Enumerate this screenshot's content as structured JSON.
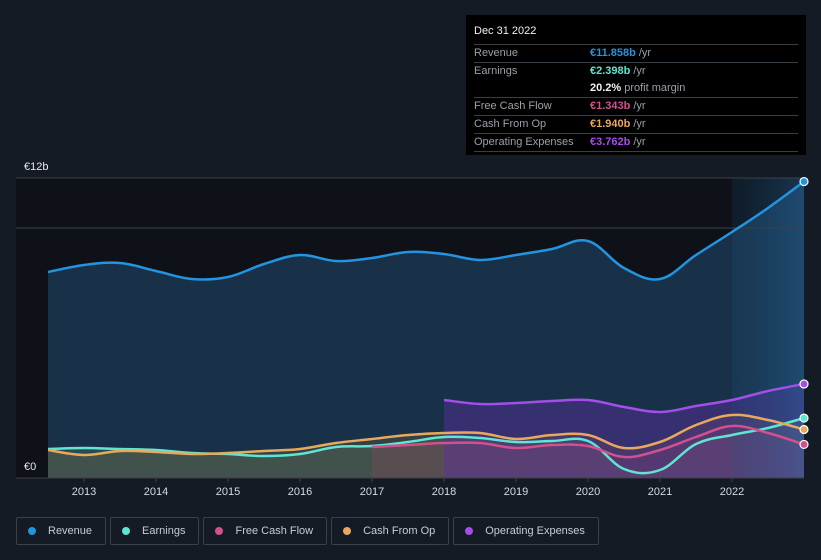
{
  "tooltip": {
    "date": "Dec 31 2022",
    "rows": [
      {
        "label": "Revenue",
        "value": "€11.858b",
        "unit": "/yr",
        "color": "#2394df"
      },
      {
        "label": "Earnings",
        "value": "€2.398b",
        "unit": "/yr",
        "color": "#5ee6d0"
      },
      {
        "label": "",
        "value": "20.2%",
        "unit": "profit margin",
        "color": "#f2f2f2"
      },
      {
        "label": "Free Cash Flow",
        "value": "€1.343b",
        "unit": "/yr",
        "color": "#d2508e"
      },
      {
        "label": "Cash From Op",
        "value": "€1.940b",
        "unit": "/yr",
        "color": "#e8a95c"
      },
      {
        "label": "Operating Expenses",
        "value": "€3.762b",
        "unit": "/yr",
        "color": "#a24ee8"
      }
    ]
  },
  "legend": [
    {
      "label": "Revenue",
      "color": "#2394df"
    },
    {
      "label": "Earnings",
      "color": "#5ee6d0"
    },
    {
      "label": "Free Cash Flow",
      "color": "#d2508e"
    },
    {
      "label": "Cash From Op",
      "color": "#e8a95c"
    },
    {
      "label": "Operating Expenses",
      "color": "#a24ee8"
    }
  ],
  "chart_data": {
    "type": "area",
    "title": "",
    "xlabel": "",
    "ylabel": "",
    "y_ticks": [
      "€0",
      "€12b"
    ],
    "ylim": [
      0,
      12
    ],
    "xlim": [
      2012.5,
      2023.0
    ],
    "x_ticks": [
      "2013",
      "2014",
      "2015",
      "2016",
      "2017",
      "2018",
      "2019",
      "2020",
      "2021",
      "2022"
    ],
    "highlight_from": 2022.0,
    "grid": true,
    "legend_position": "bottom-left",
    "series": [
      {
        "name": "Revenue",
        "color": "#2394df",
        "x": [
          2012.5,
          2013.0,
          2013.5,
          2014.0,
          2014.5,
          2015.0,
          2015.5,
          2016.0,
          2016.5,
          2017.0,
          2017.5,
          2018.0,
          2018.5,
          2019.0,
          2019.5,
          2020.0,
          2020.5,
          2021.0,
          2021.5,
          2022.0,
          2022.5,
          2023.0
        ],
        "values": [
          8.24,
          8.52,
          8.6,
          8.28,
          7.96,
          8.04,
          8.56,
          8.92,
          8.68,
          8.8,
          9.04,
          8.96,
          8.72,
          8.92,
          9.16,
          9.48,
          8.4,
          7.96,
          8.92,
          9.84,
          10.8,
          11.858
        ]
      },
      {
        "name": "Earnings",
        "color": "#5ee6d0",
        "x": [
          2012.5,
          2013.0,
          2013.5,
          2014.0,
          2014.5,
          2015.0,
          2015.5,
          2016.0,
          2016.5,
          2017.0,
          2017.5,
          2018.0,
          2018.5,
          2019.0,
          2019.5,
          2020.0,
          2020.5,
          2021.0,
          2021.5,
          2022.0,
          2022.5,
          2023.0
        ],
        "values": [
          1.16,
          1.2,
          1.16,
          1.12,
          1.0,
          0.96,
          0.88,
          0.96,
          1.24,
          1.28,
          1.44,
          1.64,
          1.6,
          1.44,
          1.48,
          1.48,
          0.36,
          0.32,
          1.36,
          1.72,
          2.0,
          2.398
        ]
      },
      {
        "name": "Free Cash Flow",
        "color": "#d2508e",
        "x": [
          2017.0,
          2017.5,
          2018.0,
          2018.5,
          2019.0,
          2019.5,
          2020.0,
          2020.5,
          2021.0,
          2021.5,
          2022.0,
          2022.5,
          2023.0
        ],
        "values": [
          1.24,
          1.32,
          1.4,
          1.4,
          1.2,
          1.32,
          1.28,
          0.84,
          1.12,
          1.64,
          2.08,
          1.8,
          1.343
        ]
      },
      {
        "name": "Cash From Op",
        "color": "#e8a95c",
        "x": [
          2012.5,
          2013.0,
          2013.5,
          2014.0,
          2014.5,
          2015.0,
          2015.5,
          2016.0,
          2016.5,
          2017.0,
          2017.5,
          2018.0,
          2018.5,
          2019.0,
          2019.5,
          2020.0,
          2020.5,
          2021.0,
          2021.5,
          2022.0,
          2022.5,
          2023.0
        ],
        "values": [
          1.12,
          0.92,
          1.08,
          1.04,
          0.96,
          1.0,
          1.08,
          1.16,
          1.4,
          1.56,
          1.72,
          1.8,
          1.8,
          1.56,
          1.72,
          1.72,
          1.2,
          1.44,
          2.12,
          2.52,
          2.32,
          1.94
        ]
      },
      {
        "name": "Operating Expenses",
        "color": "#a24ee8",
        "x": [
          2018.0,
          2018.5,
          2019.0,
          2019.5,
          2020.0,
          2020.5,
          2021.0,
          2021.5,
          2022.0,
          2022.5,
          2023.0
        ],
        "values": [
          3.12,
          2.96,
          3.0,
          3.08,
          3.12,
          2.84,
          2.64,
          2.88,
          3.12,
          3.48,
          3.762
        ]
      }
    ]
  }
}
